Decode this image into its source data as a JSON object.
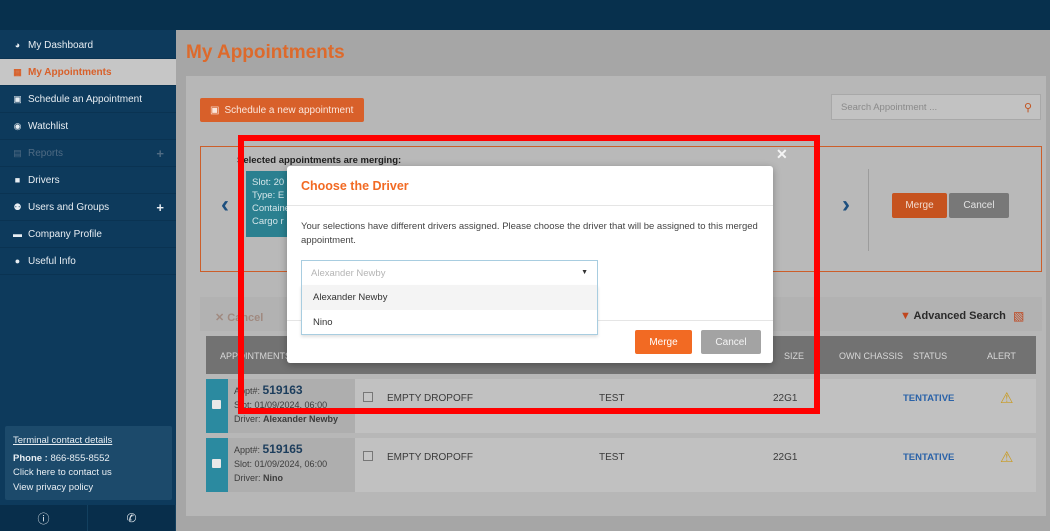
{
  "sidebar": {
    "items": [
      {
        "label": "My Dashboard",
        "icon": "dashboard-icon"
      },
      {
        "label": "My Appointments",
        "icon": "calendar-icon",
        "active": true
      },
      {
        "label": "Schedule an Appointment",
        "icon": "calendar-plus-icon"
      },
      {
        "label": "Watchlist",
        "icon": "eye-icon"
      },
      {
        "label": "Reports",
        "icon": "reports-icon",
        "disabled": true,
        "expandable": true
      },
      {
        "label": "Drivers",
        "icon": "truck-icon"
      },
      {
        "label": "Users and Groups",
        "icon": "users-icon",
        "expandable": true
      },
      {
        "label": "Company Profile",
        "icon": "briefcase-icon"
      },
      {
        "label": "Useful Info",
        "icon": "info-icon"
      }
    ],
    "contact": {
      "title": "Terminal contact details",
      "phone_label": "Phone :",
      "phone": "866-855-8552",
      "contact_link": "Click here to contact us",
      "privacy_link": "View privacy policy"
    }
  },
  "main": {
    "title": "My Appointments",
    "schedule_button": "Schedule a new appointment",
    "search_placeholder": "Search Appointment ...",
    "merge_panel": {
      "label": "Selected appointments are merging:",
      "slot_lines": [
        "Slot: 20",
        "Type: E",
        "Containe",
        "Cargo r"
      ],
      "merge": "Merge",
      "cancel": "Cancel"
    },
    "toolbar": {
      "cancel": "Cancel",
      "advanced_search": "Advanced Search"
    },
    "table": {
      "headers": [
        "APPOINTMENTS",
        "SIZE",
        "OWN CHASSIS",
        "STATUS",
        "ALERT"
      ],
      "rows": [
        {
          "appt_label": "Appt#:",
          "appt": "519163",
          "slot": "Slot: 01/09/2024, 06:00",
          "driver_label": "Driver:",
          "driver": "Alexander Newby",
          "type": "EMPTY DROPOFF",
          "container": "TEST",
          "size": "22G1",
          "status": "TENTATIVE"
        },
        {
          "appt_label": "Appt#:",
          "appt": "519165",
          "slot": "Slot: 01/09/2024, 06:00",
          "driver_label": "Driver:",
          "driver": "Nino",
          "type": "EMPTY DROPOFF",
          "container": "TEST",
          "size": "22G1",
          "status": "TENTATIVE"
        }
      ]
    }
  },
  "modal": {
    "title": "Choose the Driver",
    "text": "Your selections have different drivers assigned. Please choose the driver that will be assigned to this merged appointment.",
    "select_value": "Alexander Newby",
    "options": [
      "Alexander Newby",
      "Nino"
    ],
    "merge": "Merge",
    "cancel": "Cancel"
  },
  "colors": {
    "accent": "#f26a23",
    "sidebar": "#0d3a5c",
    "status": "#2a62a8",
    "annotation": "#ff0000"
  }
}
